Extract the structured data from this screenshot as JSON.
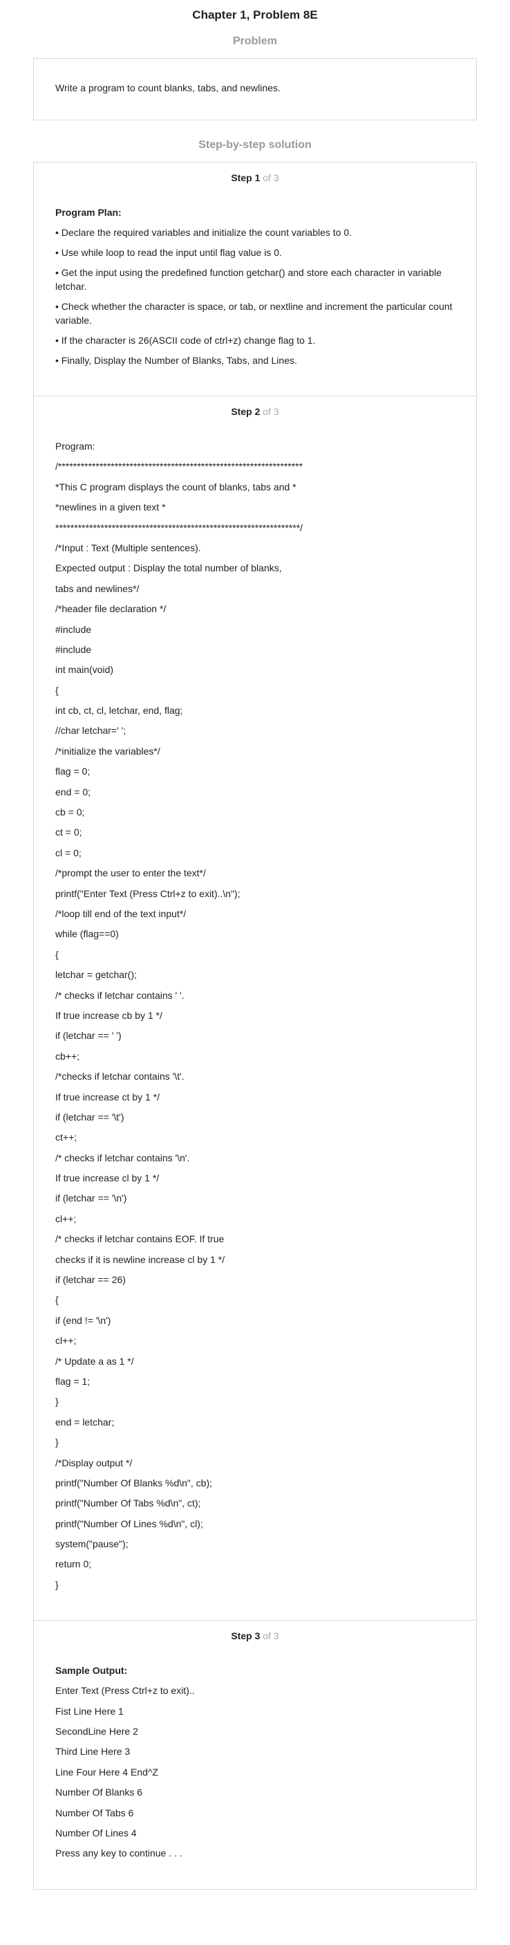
{
  "chapter_title": "Chapter 1, Problem 8E",
  "problem": {
    "heading": "Problem",
    "text": "Write a program to count blanks, tabs, and newlines."
  },
  "solution": {
    "heading": "Step-by-step solution",
    "step_word": "Step",
    "of_word": "of",
    "total_steps": "3",
    "steps": [
      {
        "number": "1",
        "heading": "Program Plan:",
        "lines": [
          "• Declare the required variables and initialize the count variables to 0.",
          "• Use while loop to read the input until flag value is 0.",
          "• Get the input using the predefined function getchar() and store each character in variable letchar.",
          "• Check whether the character is space, or tab, or nextline and increment the particular count variable.",
          "• If the character is 26(ASCII code of ctrl+z) change flag to 1.",
          "• Finally, Display the Number of Blanks, Tabs, and Lines."
        ]
      },
      {
        "number": "2",
        "heading": "",
        "lines": [
          "Program:",
          "/*****************************************************************",
          "*This C program displays the count of blanks, tabs and *",
          "*newlines in a given text *",
          "*****************************************************************/",
          "/*Input : Text (Multiple sentences).",
          "Expected output : Display the total number of blanks,",
          "tabs and newlines*/",
          "/*header file declaration */",
          "#include",
          "#include",
          "int main(void)",
          "{",
          "int cb, ct, cl, letchar, end, flag;",
          "//char letchar=' ';",
          "/*initialize the variables*/",
          "flag = 0;",
          "end = 0;",
          "cb = 0;",
          "ct = 0;",
          "cl = 0;",
          "/*prompt the user to enter the text*/",
          "printf(\"Enter Text (Press Ctrl+z to exit)..\\n\");",
          "/*loop till end of the text input*/",
          "while (flag==0)",
          "{",
          "letchar = getchar();",
          "/* checks if letchar contains ' '.",
          "If true increase cb by 1 */",
          "if (letchar == ' ')",
          "cb++;",
          "/*checks if letchar contains '\\t'.",
          "If true increase ct by 1 */",
          "if (letchar == '\\t')",
          "ct++;",
          "/* checks if letchar contains '\\n'.",
          "If true increase cl by 1 */",
          "if (letchar == '\\n')",
          "cl++;",
          "/* checks if letchar contains EOF. If true",
          "checks if it is newline increase cl by 1 */",
          "if (letchar == 26)",
          "{",
          "if (end != '\\n')",
          "cl++;",
          "/* Update a as 1 */",
          "flag = 1;",
          "}",
          "end = letchar;",
          "}",
          "/*Display output */",
          "printf(\"Number Of Blanks %d\\n\", cb);",
          "printf(\"Number Of Tabs %d\\n\", ct);",
          "printf(\"Number Of Lines %d\\n\", cl);",
          "system(\"pause\");",
          "return 0;",
          "}"
        ]
      },
      {
        "number": "3",
        "heading": "Sample Output:",
        "lines": [
          "Enter Text (Press Ctrl+z to exit)..",
          "Fist Line Here 1",
          "SecondLine Here 2",
          "Third Line Here 3",
          "Line Four Here 4 End^Z",
          "Number Of Blanks 6",
          "Number Of Tabs 6",
          "Number Of Lines 4",
          "Press any key to continue . . ."
        ]
      }
    ]
  }
}
